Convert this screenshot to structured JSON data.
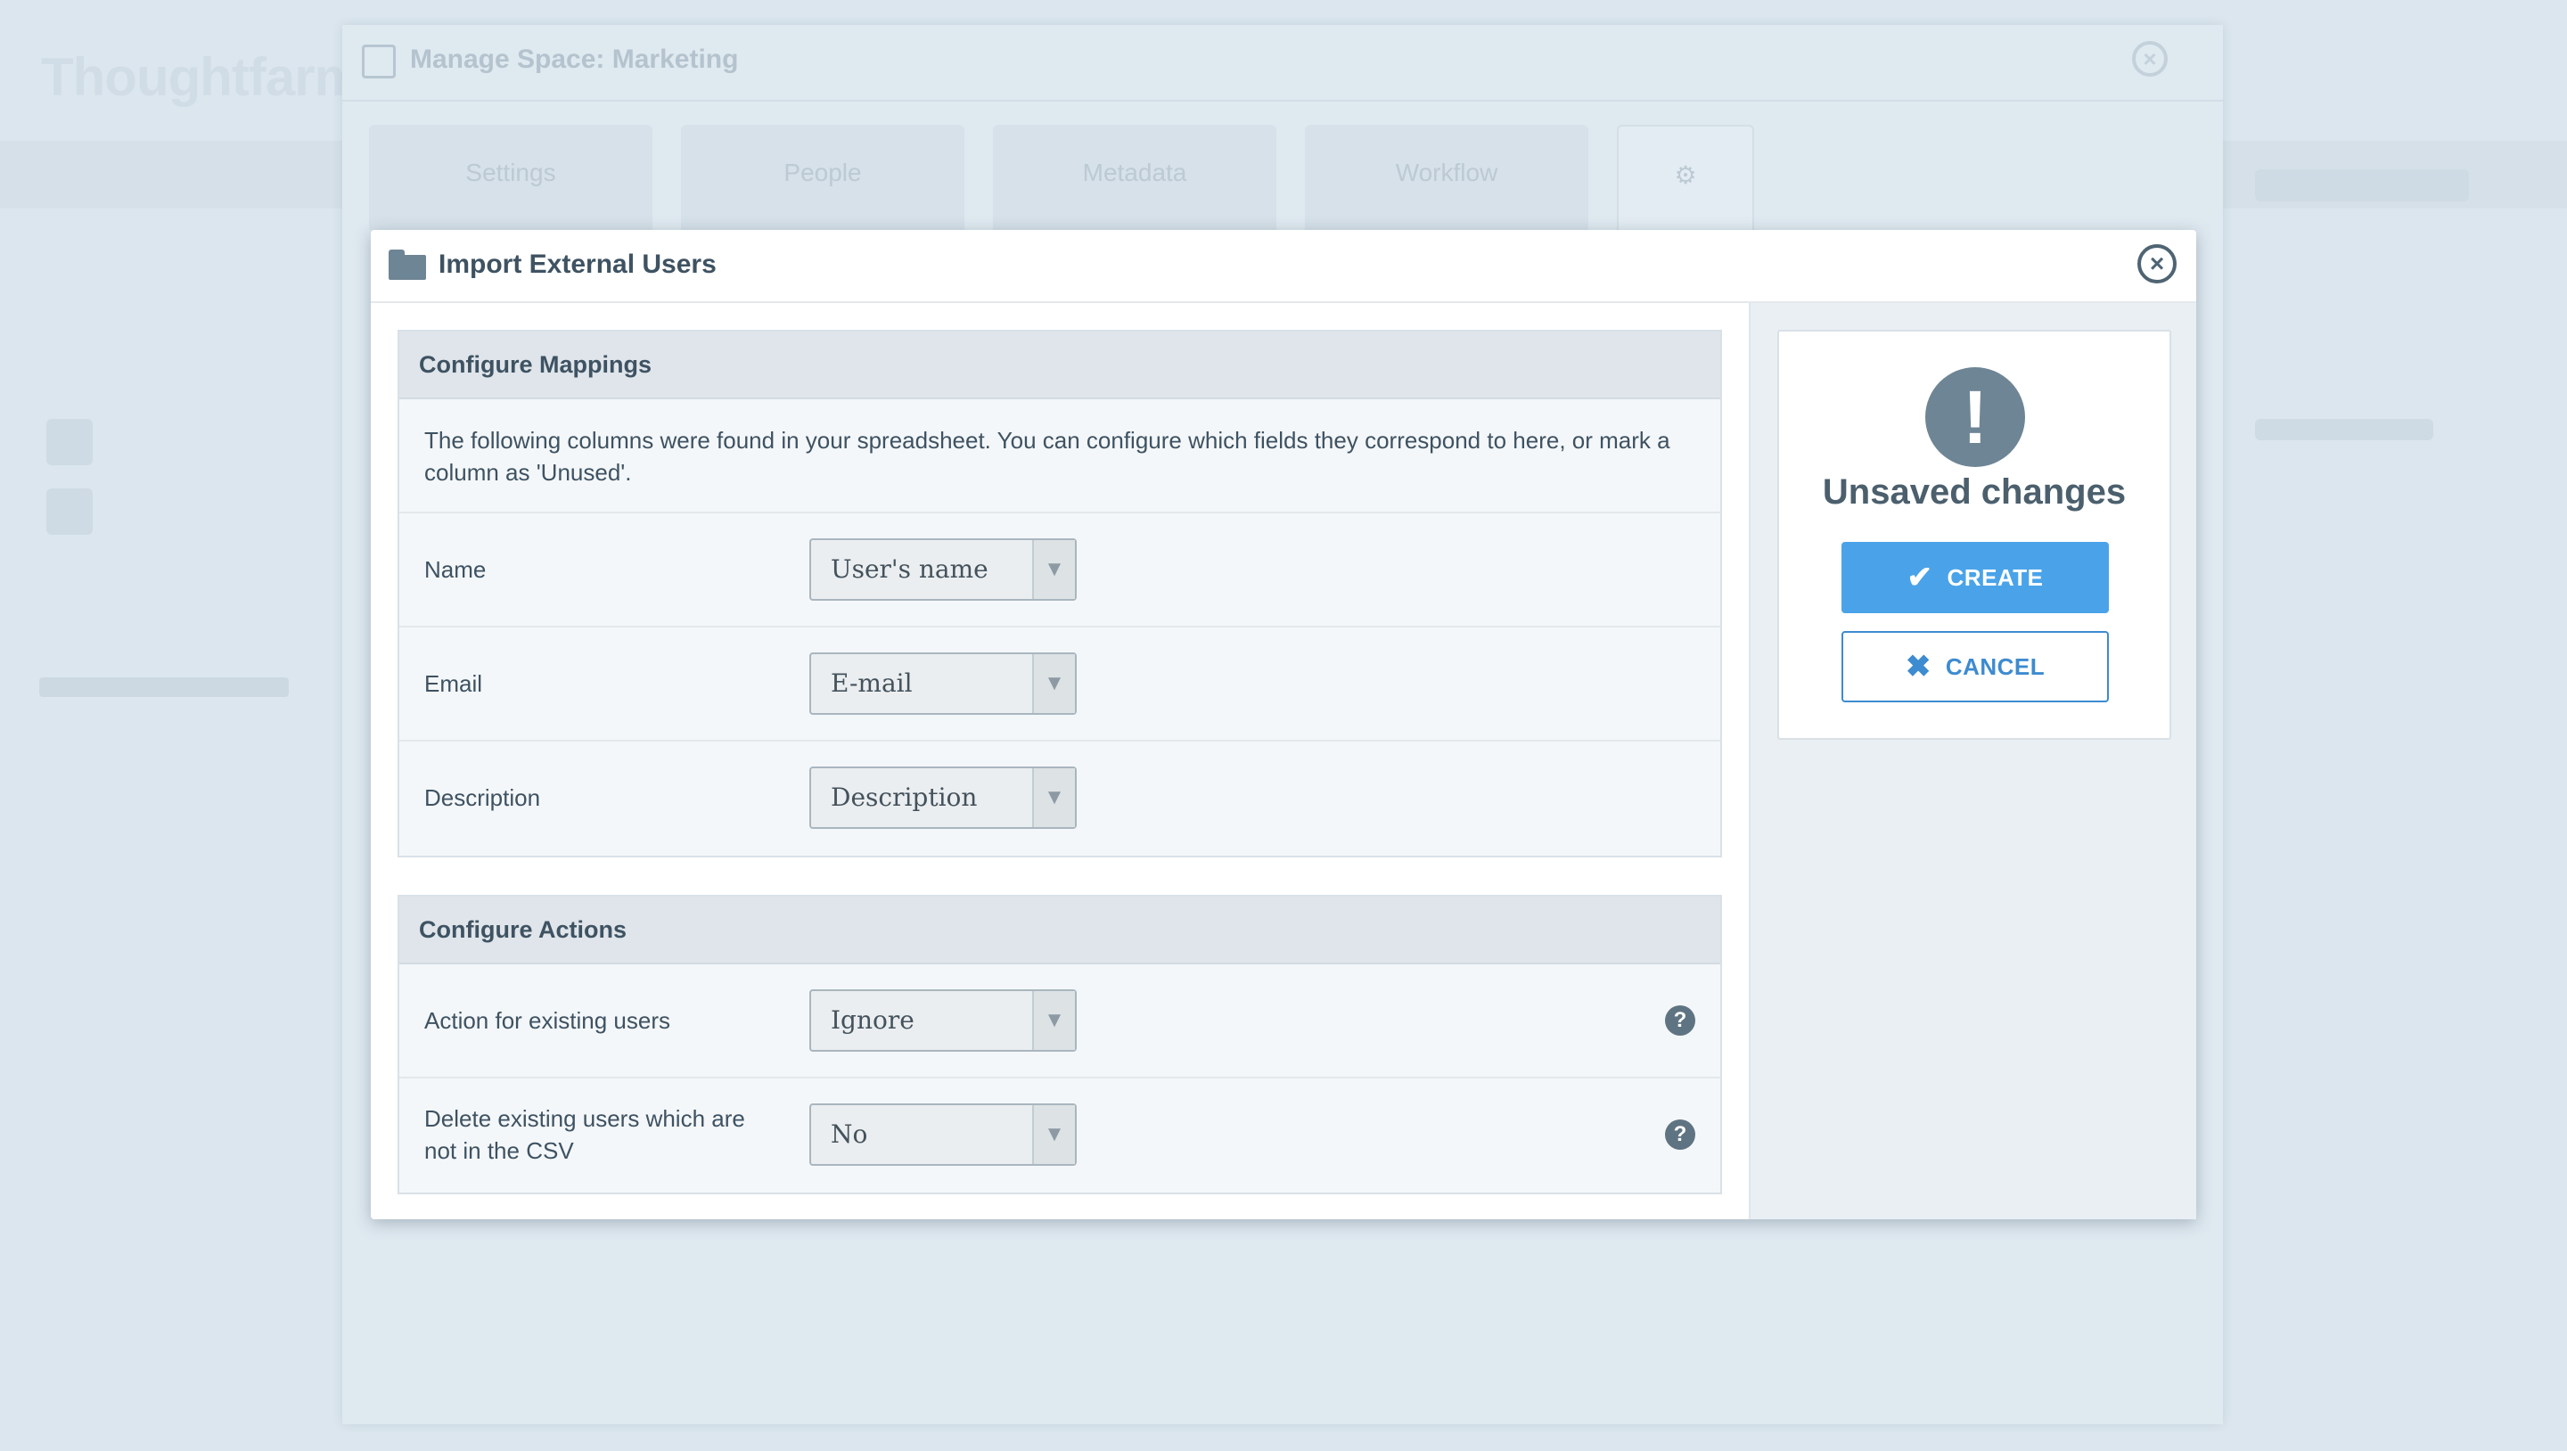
{
  "background": {
    "logo_text": "Thoughtfarmer"
  },
  "outer_dialog": {
    "title": "Manage Space: Marketing",
    "tabs": [
      {
        "label": "Settings",
        "icon": "pencil-icon"
      },
      {
        "label": "People",
        "icon": "people-icon"
      },
      {
        "label": "Metadata",
        "icon": "tag-icon"
      },
      {
        "label": "Workflow",
        "icon": "workflow-icon"
      },
      {
        "label": "",
        "icon": "gear-icon"
      }
    ]
  },
  "dialog": {
    "title": "Import External Users",
    "close_icon": "close-icon"
  },
  "mappings": {
    "heading": "Configure Mappings",
    "description": "The following columns were found in your spreadsheet. You can configure which fields they correspond to here, or mark a column as 'Unused'.",
    "rows": [
      {
        "label": "Name",
        "value": "User's name"
      },
      {
        "label": "Email",
        "value": "E-mail"
      },
      {
        "label": "Description",
        "value": "Description"
      }
    ]
  },
  "actions": {
    "heading": "Configure Actions",
    "rows": [
      {
        "label": "Action for existing users",
        "value": "Ignore"
      },
      {
        "label": "Delete existing users which are not in the CSV",
        "value": "No"
      }
    ]
  },
  "sidebar": {
    "status_title": "Unsaved changes",
    "create_label": "CREATE",
    "cancel_label": "CANCEL"
  },
  "colors": {
    "primary": "#4aa3e8",
    "cancel_border": "#3d8bd0",
    "icon_grey": "#6e8595"
  }
}
